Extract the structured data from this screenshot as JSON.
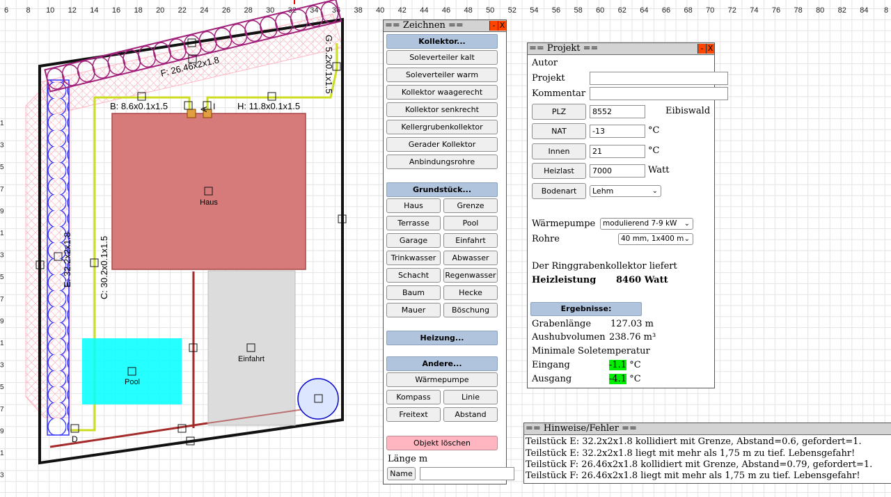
{
  "ruler": {
    "labels": [
      "6",
      "8",
      "10",
      "12",
      "14",
      "16",
      "18",
      "20",
      "22",
      "24",
      "26",
      "28",
      "30",
      "32",
      "34",
      "36",
      "38",
      "40",
      "42",
      "44",
      "46",
      "48",
      "50",
      "52",
      "54",
      "56",
      "58",
      "60",
      "62",
      "64",
      "66",
      "68",
      "70",
      "72",
      "74",
      "76",
      "78",
      "80",
      "82",
      "84",
      "8"
    ],
    "left_labels": [
      "1",
      "3",
      "5",
      "7",
      "9",
      "1",
      "3",
      "5",
      "7",
      "9",
      "1",
      "3",
      "5",
      "7",
      "9",
      "1",
      "3"
    ]
  },
  "canvas": {
    "pipe_labels": {
      "b": "B: 8.6x0.1x1.5",
      "h": "H: 11.8x0.1x1.5",
      "f": "F: 26.46x2x1.8",
      "g": "G: 5.2x0.1x1.5",
      "e": "E: 32.2x2x1.8",
      "c": "C: 30.2x0.1x1.5",
      "d": "D",
      "a": "A",
      "i": "I"
    },
    "house_label": "Haus",
    "pool_label": "Pool",
    "drive_label": "Einfahrt"
  },
  "zeichnen": {
    "title": "== Zeichnen ==",
    "minimize": "-",
    "close": "X",
    "kollektor_header": "Kollektor...",
    "kollektor_items": [
      "Soleverteiler kalt",
      "Soleverteiler warm",
      "Kollektor waagerecht",
      "Kollektor senkrecht",
      "Kellergrubenkollektor",
      "Gerader Kollektor",
      "Anbindungsrohre"
    ],
    "grundstueck_header": "Grundstück...",
    "grundstueck_items": [
      "Haus",
      "Grenze",
      "Terrasse",
      "Pool",
      "Garage",
      "Einfahrt",
      "Trinkwasser",
      "Abwasser",
      "Schacht",
      "Regenwasser",
      "Baum",
      "Hecke",
      "Mauer",
      "Böschung"
    ],
    "heizung_header": "Heizung...",
    "andere_header": "Andere...",
    "waermepumpe_button": "Wärmepumpe",
    "kompass_button": "Kompass",
    "linie_button": "Linie",
    "freitext_button": "Freitext",
    "abstand_button": "Abstand",
    "delete_button": "Objekt löschen",
    "length_label": "Länge m",
    "name_button": "Name",
    "name_value": ""
  },
  "projekt": {
    "title": "== Projekt ==",
    "minimize": "-",
    "close": "X",
    "autor_label": "Autor",
    "projekt_label": "Projekt",
    "projekt_value": "",
    "kommentar_label": "Kommentar",
    "kommentar_value": "",
    "plz_button": "PLZ",
    "plz_value": "8552",
    "plz_city": "Eibiswald",
    "nat_button": "NAT",
    "nat_value": "-13",
    "nat_unit": "°C",
    "innen_button": "Innen",
    "innen_value": "21",
    "innen_unit": "°C",
    "heizlast_button": "Heizlast",
    "heizlast_value": "7000",
    "heizlast_unit": "Watt",
    "bodenart_button": "Bodenart",
    "bodenart_value": "Lehm",
    "waermepumpe_label": "Wärmepumpe",
    "waermepumpe_value": "modulierend 7-9 kW",
    "rohre_label": "Rohre",
    "rohre_value": "40 mm, 1x400 m",
    "result_intro": "Der Ringgrabenkollektor liefert",
    "heizleistung_label": "Heizleistung",
    "heizleistung_value": "8460 Watt",
    "ergebnisse_header": "Ergebnisse:",
    "grabenlaenge_label": "Grabenlänge",
    "grabenlaenge_value": "127.03 m",
    "aushub_label": "Aushubvolumen",
    "aushub_value": "238.76 m³",
    "minsole_label": "Minimale Soletemperatur",
    "eingang_label": "Eingang",
    "eingang_value": "-1.1",
    "eingang_unit": "°C",
    "ausgang_label": "Ausgang",
    "ausgang_value": "-4.1",
    "ausgang_unit": "°C",
    "highlight_color": "#00ee00"
  },
  "hinweise": {
    "title": "== Hinweise/Fehler ==",
    "messages": [
      "Teilstück E: 32.2x2x1.8 kollidiert mit Grenze, Abstand=0.6, gefordert=1.",
      "Teilstück E: 32.2x2x1.8 liegt mit mehr als 1,75 m zu tief. Lebensgefahr!",
      "Teilstück F: 26.46x2x1.8 kollidiert mit Grenze, Abstand=0.79, gefordert=1.",
      "Teilstück F: 26.46x2x1.8 liegt mit mehr als 1,75 m zu tief. Lebensgefahr!"
    ]
  }
}
